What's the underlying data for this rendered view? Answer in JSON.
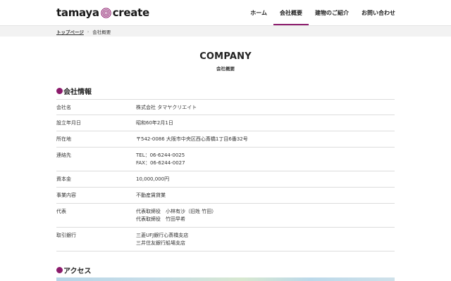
{
  "header": {
    "logo_left": "tamaya",
    "logo_right": "create",
    "brand_color": "#8b1a6b",
    "nav": [
      {
        "label": "ホーム",
        "active": false
      },
      {
        "label": "会社概要",
        "active": true
      },
      {
        "label": "建物のご紹介",
        "active": false
      },
      {
        "label": "お問い合わせ",
        "active": false
      }
    ]
  },
  "breadcrumb": {
    "home": "トップページ",
    "separator": "›",
    "current": "会社概要"
  },
  "page": {
    "title": "COMPANY",
    "subtitle": "会社概要"
  },
  "company_section": {
    "heading": "会社情報",
    "rows": [
      {
        "label": "会社名",
        "lines": [
          "株式会社 タマヤクリエイト"
        ]
      },
      {
        "label": "設立年月日",
        "lines": [
          "昭和60年2月1日"
        ]
      },
      {
        "label": "所在地",
        "lines": [
          "〒542-0086 大阪市中央区西心斎橋1丁目6番32号"
        ]
      },
      {
        "label": "連絡先",
        "lines": [
          "TEL：06-6244-0025",
          "FAX：06-6244-0027"
        ]
      },
      {
        "label": "資本金",
        "lines": [
          "10,000,000円"
        ]
      },
      {
        "label": "事業内容",
        "lines": [
          "不動産賃貸業"
        ]
      },
      {
        "label": "代表",
        "lines": [
          "代表取締役　小林有沙（旧姓 竹田）",
          "代表取締役　竹田早希"
        ]
      },
      {
        "label": "取引銀行",
        "lines": [
          "三菱UFJ銀行心斎橋支店",
          "三井住友銀行船場支店"
        ]
      }
    ]
  },
  "access_section": {
    "heading": "アクセス"
  }
}
